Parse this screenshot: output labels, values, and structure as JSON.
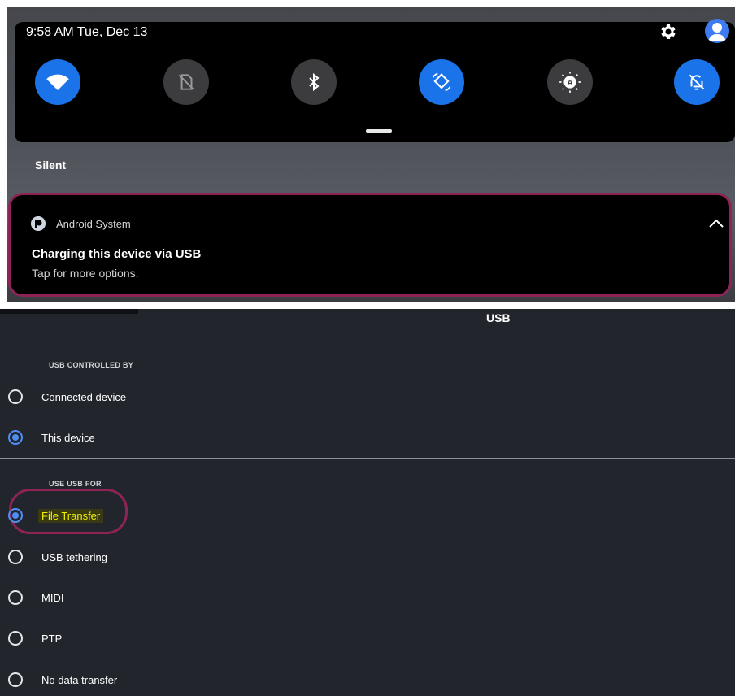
{
  "status_bar": {
    "time_date": "9:58 AM  Tue, Dec 13",
    "settings_icon": "gear-icon",
    "avatar_icon": "user-avatar-icon"
  },
  "quick_tiles": [
    {
      "name": "wifi",
      "icon": "wifi-icon",
      "state": "on"
    },
    {
      "name": "no-sim",
      "icon": "no-sim-icon",
      "state": "off"
    },
    {
      "name": "bluetooth",
      "icon": "bluetooth-icon",
      "state": "off"
    },
    {
      "name": "auto-rotate",
      "icon": "auto-rotate-icon",
      "state": "on"
    },
    {
      "name": "auto-brightness",
      "icon": "auto-brightness-icon",
      "state": "off"
    },
    {
      "name": "do-not-disturb",
      "icon": "bell-off-icon",
      "state": "on"
    }
  ],
  "shade": {
    "section": "Silent"
  },
  "notification": {
    "app": "Android System",
    "title": "Charging this device via USB",
    "text": "Tap for more options."
  },
  "usb": {
    "title": "USB",
    "controlled_by_label": "USB CONTROLLED BY",
    "controlled_by": [
      {
        "label": "Connected device",
        "selected": false
      },
      {
        "label": "This device",
        "selected": true
      }
    ],
    "use_for_label": "USE USB FOR",
    "use_for": [
      {
        "label": "File Transfer",
        "selected": true
      },
      {
        "label": "USB tethering",
        "selected": false
      },
      {
        "label": "MIDI",
        "selected": false
      },
      {
        "label": "PTP",
        "selected": false
      },
      {
        "label": "No data transfer",
        "selected": false
      }
    ]
  },
  "colors": {
    "accent": "#1a73e8",
    "annotation": "#8e2356",
    "highlight": "#f2f200"
  }
}
